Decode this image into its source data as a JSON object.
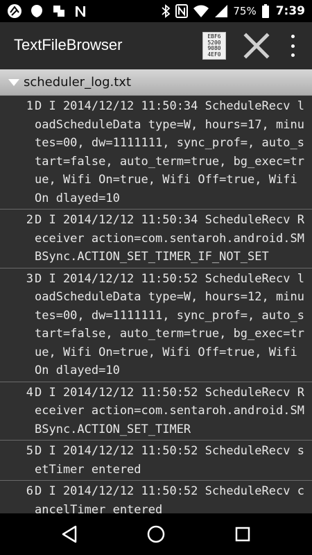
{
  "status_bar": {
    "battery_percent": "75%",
    "time": "7:39"
  },
  "app_bar": {
    "title": "TextFileBrowser",
    "hex_icon_text": [
      "EBF6",
      "5200",
      "9080",
      "4EF0"
    ]
  },
  "file_header": {
    "filename": "scheduler_log.txt"
  },
  "log_lines": [
    {
      "num": "1",
      "text": "D I 2014/12/12 11:50:34 ScheduleRecv loadScheduleData type=W, hours=17, minutes=00, dw=1111111, sync_prof=, auto_start=false, auto_term=true, bg_exec=true, Wifi On=true, Wifi Off=true, Wifi On dlayed=10"
    },
    {
      "num": "2",
      "text": "D I 2014/12/12 11:50:34 ScheduleRecv Receiver action=com.sentaroh.android.SMBSync.ACTION_SET_TIMER_IF_NOT_SET"
    },
    {
      "num": "3",
      "text": "D I 2014/12/12 11:50:52 ScheduleRecv loadScheduleData type=W, hours=12, minutes=00, dw=1111111, sync_prof=, auto_start=false, auto_term=true, bg_exec=true, Wifi On=true, Wifi Off=true, Wifi On dlayed=10"
    },
    {
      "num": "4",
      "text": "D I 2014/12/12 11:50:52 ScheduleRecv Receiver action=com.sentaroh.android.SMBSync.ACTION_SET_TIMER"
    },
    {
      "num": "5",
      "text": "D I 2014/12/12 11:50:52 ScheduleRecv setTimer entered"
    },
    {
      "num": "6",
      "text": "D I 2014/12/12 11:50:52 ScheduleRecv cancelTimer entered"
    }
  ]
}
